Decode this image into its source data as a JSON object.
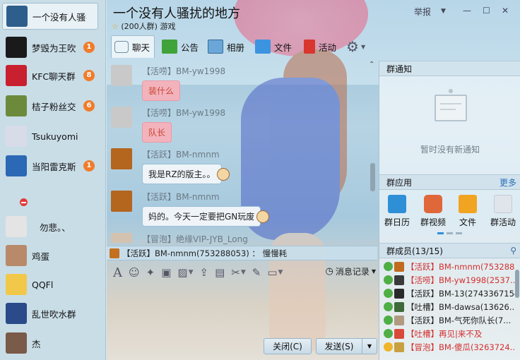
{
  "contacts": [
    {
      "name": "一个没有人骚扰",
      "badge": "",
      "color": "#2e5f8c"
    },
    {
      "name": "梦毁为王吹",
      "badge": "1",
      "color": "#1a1a1a"
    },
    {
      "name": "KFC聊天群",
      "badge": "8",
      "color": "#c8202f"
    },
    {
      "name": "桔子粉丝交",
      "badge": "6",
      "color": "#6c8a3c"
    },
    {
      "name": "Tsukuyomi",
      "badge": "",
      "color": "#d8dbe8"
    },
    {
      "name": "当阳雷克斯",
      "badge": "1",
      "color": "#2b68b5"
    },
    {
      "name": "勿悲。、",
      "badge": "",
      "color": "#e4e4e4"
    },
    {
      "name": "鸡蛋",
      "badge": "",
      "color": "#b88a6a"
    },
    {
      "name": "QQFl",
      "badge": "",
      "color": "#f2c84a"
    },
    {
      "name": "乱世吹水群",
      "badge": "",
      "color": "#2b4a8a"
    },
    {
      "name": "杰",
      "badge": "",
      "color": "#7a5a48"
    }
  ],
  "header": {
    "title": "一个没有人骚扰的地方",
    "members_count": "(200人群)",
    "category": "游戏",
    "report": "举报"
  },
  "tabs": [
    {
      "label": "聊天"
    },
    {
      "label": "公告"
    },
    {
      "label": "相册"
    },
    {
      "label": "文件"
    },
    {
      "label": "活动"
    }
  ],
  "messages": [
    {
      "name": "【活唠】BM-yw1998",
      "text": "装什么",
      "style": "pink"
    },
    {
      "name": "【活唠】BM-yw1998",
      "text": "队长",
      "style": "pink"
    },
    {
      "name": "【活跃】BM-nmnm",
      "text": "我是RZ的版主。。",
      "style": "white"
    },
    {
      "name": "【活跃】BM-nmnm",
      "text": "妈的。今天一定要把GN玩废",
      "style": "white"
    },
    {
      "name": "【冒泡】绝缘VIP-JYB_Long",
      "text": "",
      "style": "none"
    }
  ],
  "notice_bar": {
    "text": "【活跃】BM-nmnm(753288053) ： 慢慢耗"
  },
  "toolbar": {
    "history": "消息记录"
  },
  "buttons": {
    "close": "关闭(C)",
    "send": "发送(S)"
  },
  "right_panel": {
    "notice_title": "群通知",
    "notice_empty": "暂时没有新通知",
    "apps_title": "群应用",
    "apps_more": "更多",
    "apps": [
      {
        "label": "群日历",
        "color": "#2e8fd6"
      },
      {
        "label": "群视频",
        "color": "#e0673a"
      },
      {
        "label": "文件",
        "color": "#f0a421"
      },
      {
        "label": "群活动",
        "color": "#c9d1d8"
      }
    ],
    "members_title": "群成员(13/15)",
    "members": [
      {
        "level": "【活跃】",
        "name": "BM-nmnm(753288...",
        "plain": false,
        "color": "#c26a1e"
      },
      {
        "level": "【活唠】",
        "name": "BM-yw1998(2537...",
        "plain": false,
        "color": "#3a3a3a"
      },
      {
        "level": "【活跃】",
        "name": "BM-13(2743367154)",
        "plain": true,
        "color": "#2a2a2a"
      },
      {
        "level": "【吐槽】",
        "name": "BM-dawsa(13626...",
        "plain": true,
        "color": "#3f6a3a"
      },
      {
        "level": "【活跃】",
        "name": "BM-气死你队长(7...",
        "plain": true,
        "color": "#b09a80"
      },
      {
        "level": "【吐槽】",
        "name": "再见|来不及",
        "plain": false,
        "color": "#d84a3a"
      },
      {
        "level": "【冒泡】",
        "name": "BM-傻瓜(3263724...",
        "plain": false,
        "color": "#c8a040"
      }
    ]
  }
}
